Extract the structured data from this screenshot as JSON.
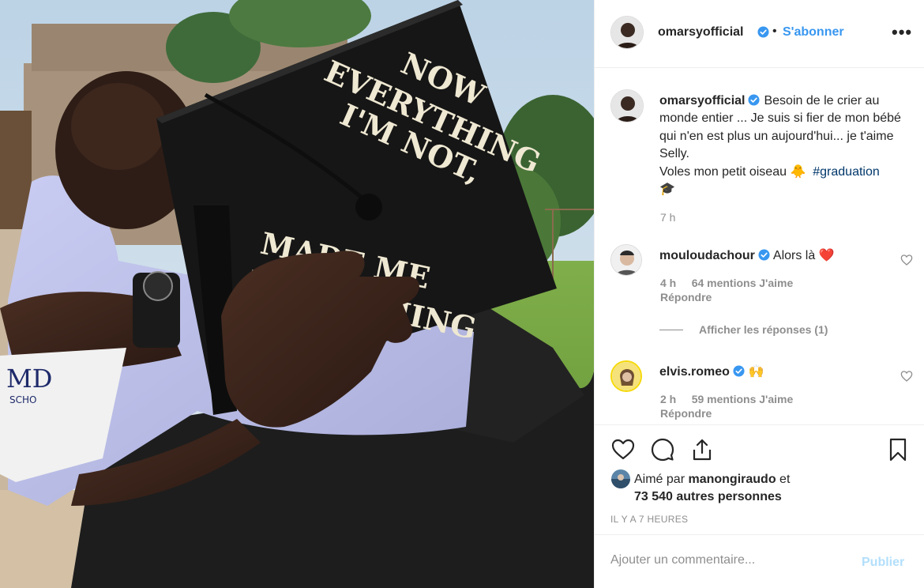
{
  "photo": {
    "cap_text_line1": "NOW",
    "cap_text_line2": "EVERYTHING",
    "cap_text_line3": "I'M NOT,",
    "cap_text_line4": "MADE ME",
    "cap_text_line5": "EVERYTHING",
    "paper_text": "MD",
    "paper_text2": "SCHO"
  },
  "header": {
    "username": "omarsyofficial",
    "dot": "•",
    "follow_label": "S'abonner",
    "more_icon": "•••"
  },
  "caption": {
    "username": "omarsyofficial",
    "text_part1": "Besoin de le crier au monde entier ... Je suis si fier de mon bébé qui n'en est plus un aujourd'hui... je t'aime Selly.",
    "text_part2": "Voles mon petit oiseau 🐥",
    "hashtag": "#graduation",
    "text_part3": "🎓",
    "time": "7 h"
  },
  "comments": [
    {
      "username": "mouloudachour",
      "text": "Alors là ❤️",
      "time": "4 h",
      "likes": "64 mentions J'aime",
      "reply": "Répondre",
      "view_replies": "Afficher les réponses (1)"
    },
    {
      "username": "elvis.romeo",
      "text": "🙌",
      "time": "2 h",
      "likes": "59 mentions J'aime",
      "reply": "Répondre"
    }
  ],
  "likes": {
    "prefix": "Aimé par",
    "user": "manongiraudo",
    "suffix": "et",
    "others": "73 540 autres personnes"
  },
  "post_time": "IL Y A 7 HEURES",
  "add_comment": {
    "placeholder": "Ajouter un commentaire...",
    "publish_label": "Publier"
  },
  "colors": {
    "link": "#3897f0",
    "verified": "#3897f0",
    "hashtag": "#00376b",
    "muted": "#8e8e8e",
    "publish_disabled": "#b2dffc"
  }
}
